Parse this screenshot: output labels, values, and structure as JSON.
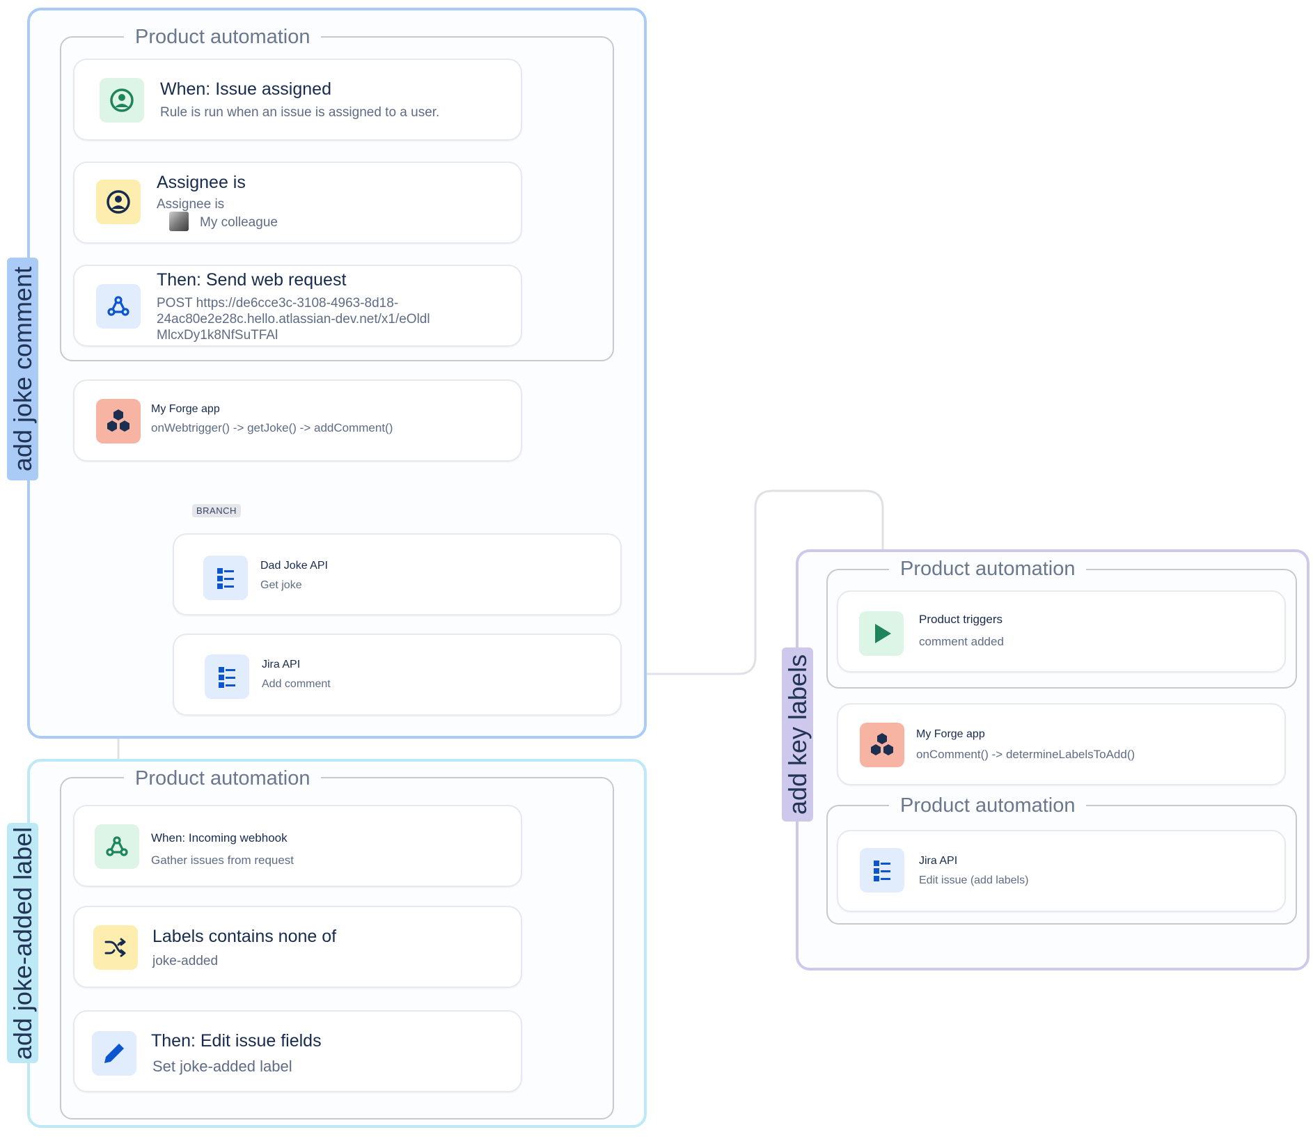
{
  "colors": {
    "blue_frame": "#a9cbf5",
    "cyan_frame": "#bde9f7",
    "purple_frame": "#cdc8ec",
    "connector": "#dfe1e6"
  },
  "flows": [
    {
      "label": "add joke comment",
      "group_title": "Product automation",
      "steps": [
        {
          "icon": "user-circle-icon",
          "title": "When: Issue assigned",
          "subtitle": "Rule is run when an issue is assigned to a user."
        },
        {
          "icon": "user-circle-icon",
          "title": "Assignee is",
          "subtitle": "Assignee is",
          "user": "My colleague"
        },
        {
          "icon": "webhook-icon",
          "title": "Then: Send web request",
          "lines": [
            "POST https://de6cce3c-3108-4963-8d18-",
            "24ac80e2e28c.hello.atlassian-dev.net/x1/eOldl",
            "MlcxDy1k8NfSuTFAl"
          ]
        }
      ],
      "app": {
        "icon": "forge-hexagons-icon",
        "title": "My Forge app",
        "subtitle": "onWebtrigger() -> getJoke() -> addComment()"
      },
      "branch_label": "BRANCH",
      "branch_steps": [
        {
          "icon": "api-tree-icon",
          "title": "Dad Joke API",
          "subtitle": "Get joke"
        },
        {
          "icon": "api-tree-icon",
          "title": "Jira API",
          "subtitle": "Add comment"
        }
      ]
    },
    {
      "label": "add joke-added label",
      "group_title": "Product automation",
      "steps": [
        {
          "icon": "webhook-icon",
          "title": "When: Incoming webhook",
          "subtitle": "Gather issues from request"
        },
        {
          "icon": "shuffle-icon",
          "title": "Labels contains none of",
          "subtitle": "joke-added"
        },
        {
          "icon": "pencil-icon",
          "title": "Then: Edit issue fields",
          "subtitle": "Set joke-added label"
        }
      ]
    },
    {
      "label": "add key labels",
      "group_title": "Product automation",
      "trigger": {
        "icon": "play-icon",
        "title": "Product triggers",
        "subtitle": "comment added"
      },
      "app": {
        "icon": "forge-hexagons-icon",
        "title": "My Forge app",
        "subtitle": "onComment() -> determineLabelsToAdd()"
      },
      "group2_title": "Product automation",
      "action": {
        "icon": "api-tree-icon",
        "title": "Jira API",
        "subtitle": "Edit issue (add labels)"
      }
    }
  ]
}
